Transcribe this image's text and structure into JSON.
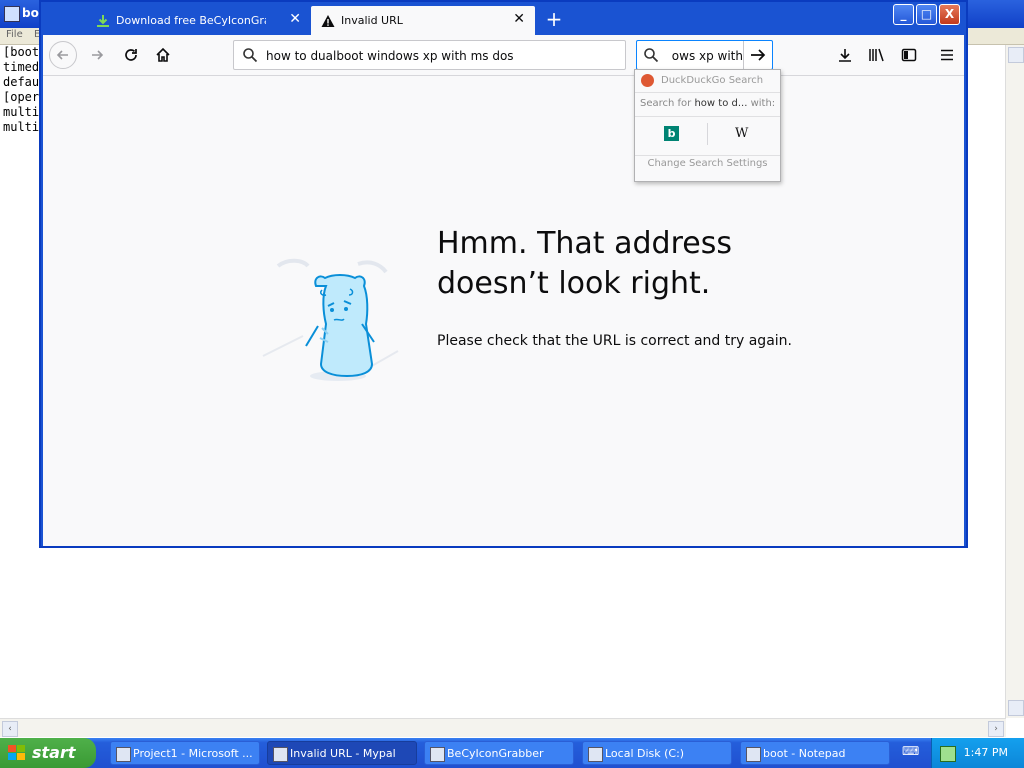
{
  "notepad": {
    "title": "boo",
    "menu": [
      "File",
      "E"
    ],
    "lines": [
      "[boot",
      "timed",
      "defau",
      "[oper",
      "multi",
      "multi"
    ]
  },
  "browser": {
    "tabs": [
      {
        "title": "Download free BeCyIconGrabber",
        "icon": "download-icon",
        "active": false
      },
      {
        "title": "Invalid URL",
        "icon": "warning-icon",
        "active": true
      }
    ],
    "new_tab": "+",
    "window_buttons": {
      "minimize": "_",
      "maximize": "□",
      "close": "X"
    },
    "url": "how to dualboot windows xp with ms dos",
    "search_value": "ows xp with",
    "error": {
      "title_line1": "Hmm. That address",
      "title_line2": "doesn’t look right.",
      "description": "Please check that the URL is correct and try again."
    },
    "search_popup": {
      "engine": "DuckDuckGo Search",
      "search_for_prefix": "Search for ",
      "search_for_term": "how to d...",
      "search_for_suffix": " with:",
      "engines": [
        "bing-icon",
        "wikipedia-icon"
      ],
      "wiki_letter": "W",
      "bing_letter": "b",
      "settings": "Change Search Settings"
    }
  },
  "taskbar": {
    "start": "start",
    "items": [
      {
        "label": "Project1 - Microsoft ...",
        "active": false
      },
      {
        "label": "Invalid URL - Mypal",
        "active": true
      },
      {
        "label": "BeCyIconGrabber",
        "active": false
      },
      {
        "label": "Local Disk (C:)",
        "active": false
      },
      {
        "label": "boot - Notepad",
        "active": false
      }
    ],
    "clock": "1:47 PM"
  },
  "colors": {
    "xp_blue": "#245edb",
    "start_green": "#3a9a34",
    "accent": "#0a84ff"
  }
}
